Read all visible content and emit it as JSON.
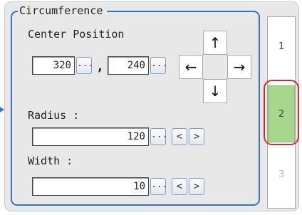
{
  "group": {
    "title": "Circumference"
  },
  "center": {
    "label": "Center Position",
    "x_value": "320",
    "y_value": "240",
    "separator": ",",
    "browse_label": "...",
    "arrows": {
      "up": "↑",
      "down": "↓",
      "left": "←",
      "right": "→"
    }
  },
  "radius": {
    "label": "Radius :",
    "value": "120",
    "browse_label": "...",
    "dec_label": "<",
    "inc_label": ">"
  },
  "width": {
    "label": "Width :",
    "value": "10",
    "browse_label": "...",
    "dec_label": "<",
    "inc_label": ">"
  },
  "tabs": [
    {
      "label": "1",
      "selected": false
    },
    {
      "label": "2",
      "selected": true
    },
    {
      "label": "3",
      "selected": false
    }
  ],
  "colors": {
    "group_border": "#3a75b8",
    "tab_selected": "#a7d78d",
    "highlight": "#d62b2b"
  }
}
